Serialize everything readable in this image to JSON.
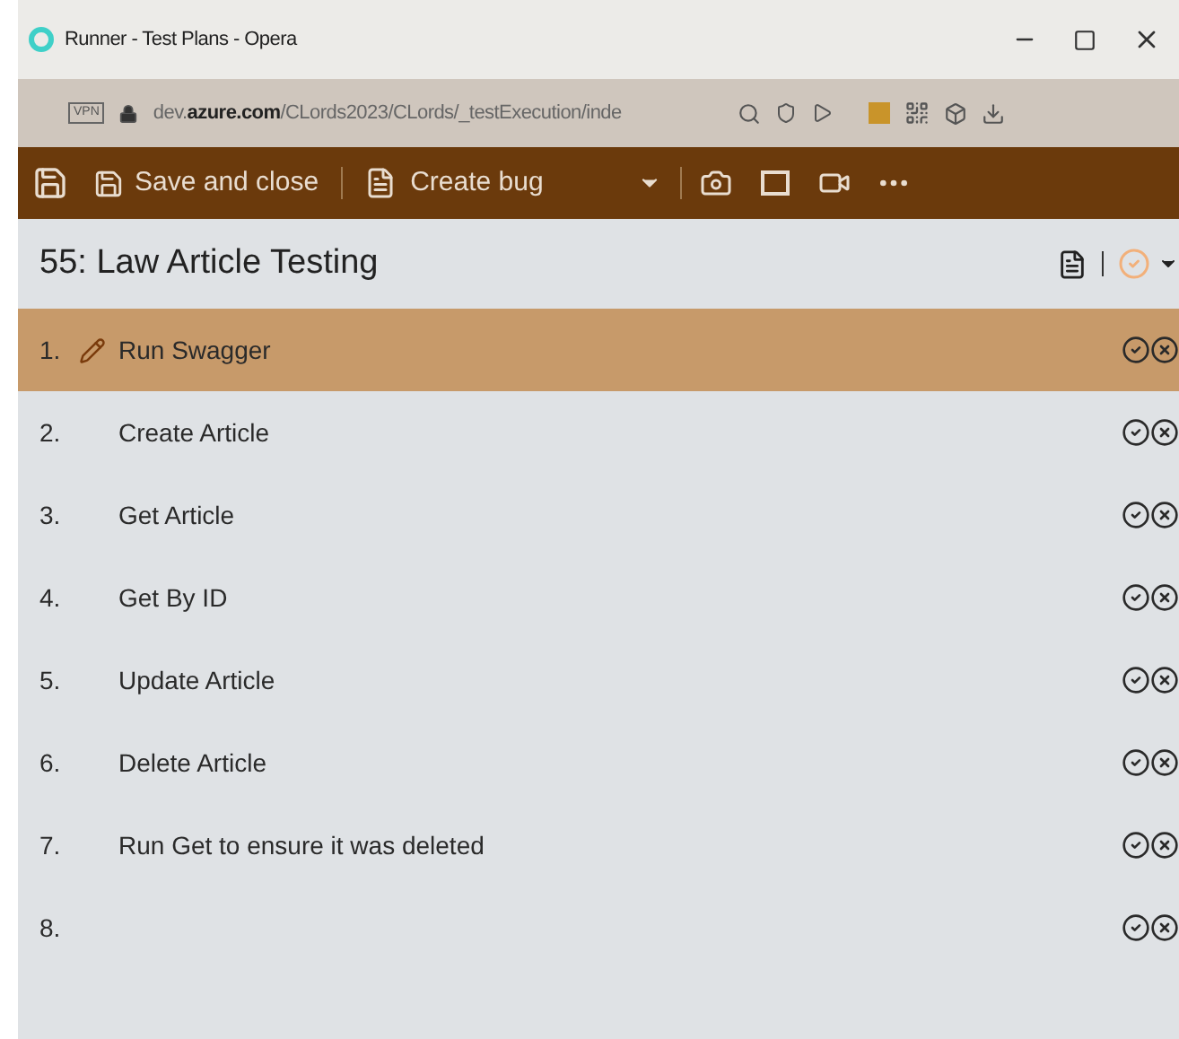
{
  "window": {
    "title": "Runner - Test Plans - Opera"
  },
  "address_bar": {
    "vpn": "VPN",
    "url_prefix": "dev.",
    "url_domain": "azure.com",
    "url_path": "/CLords2023/CLords/_testExecution/inde"
  },
  "toolbar": {
    "buttons": [
      {
        "label": "Save and close"
      },
      {
        "label": "Create bug"
      }
    ]
  },
  "test_case": {
    "title": "55: Law Article Testing"
  },
  "steps": [
    {
      "number": "1.",
      "text": "Run Swagger",
      "selected": true
    },
    {
      "number": "2.",
      "text": "Create Article",
      "selected": false
    },
    {
      "number": "3.",
      "text": "Get Article",
      "selected": false
    },
    {
      "number": "4.",
      "text": "Get By ID",
      "selected": false
    },
    {
      "number": "5.",
      "text": "Update Article",
      "selected": false
    },
    {
      "number": "6.",
      "text": "Delete Article",
      "selected": false
    },
    {
      "number": "7.",
      "text": "Run Get to ensure it was deleted",
      "selected": false
    },
    {
      "number": "8.",
      "selected": false
    }
  ]
}
